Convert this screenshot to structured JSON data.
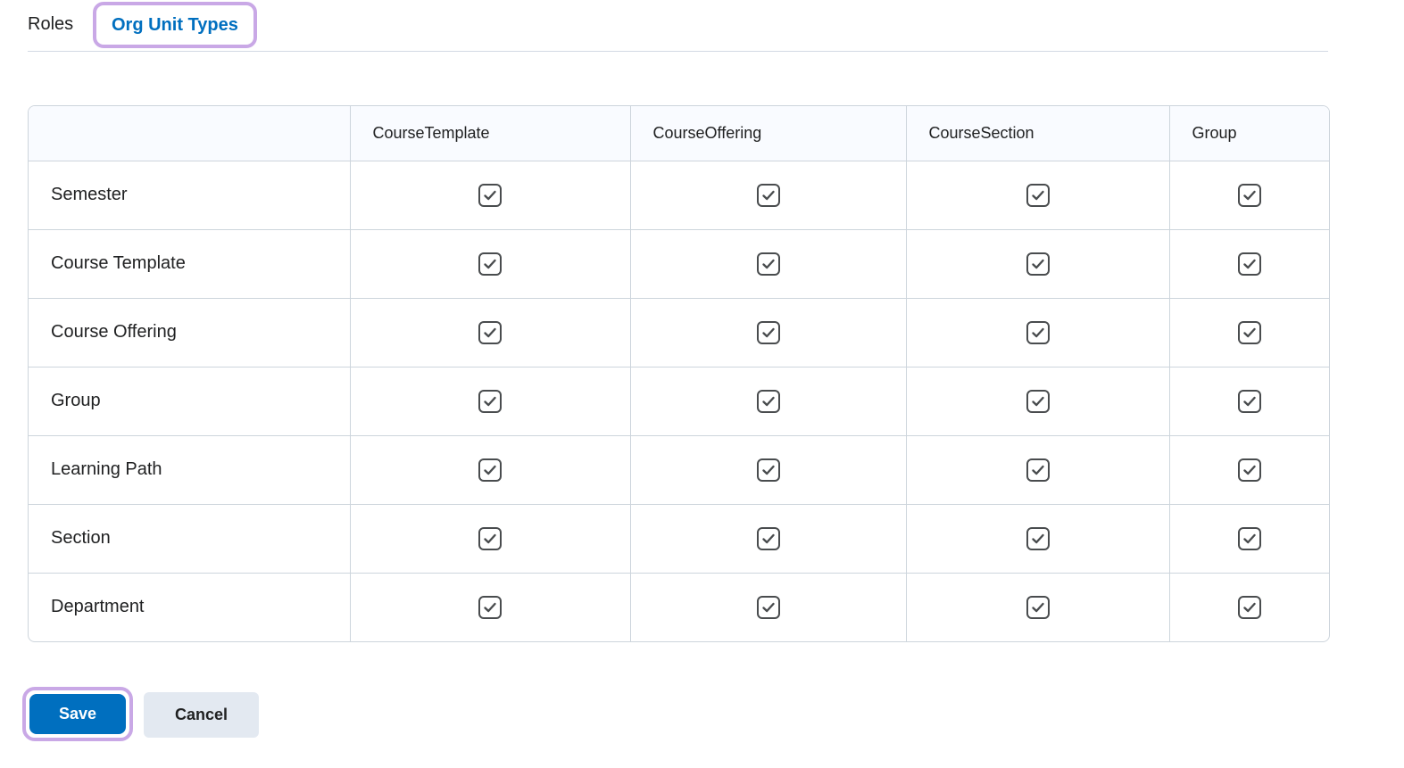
{
  "tabs": {
    "roles": "Roles",
    "org_unit_types": "Org Unit Types"
  },
  "table": {
    "columns": [
      "CourseTemplate",
      "CourseOffering",
      "CourseSection",
      "Group"
    ],
    "rows": [
      {
        "label": "Semester",
        "checked": [
          true,
          true,
          true,
          true
        ]
      },
      {
        "label": "Course Template",
        "checked": [
          true,
          true,
          true,
          true
        ]
      },
      {
        "label": "Course Offering",
        "checked": [
          true,
          true,
          true,
          true
        ]
      },
      {
        "label": "Group",
        "checked": [
          true,
          true,
          true,
          true
        ]
      },
      {
        "label": "Learning Path",
        "checked": [
          true,
          true,
          true,
          true
        ]
      },
      {
        "label": "Section",
        "checked": [
          true,
          true,
          true,
          true
        ]
      },
      {
        "label": "Department",
        "checked": [
          true,
          true,
          true,
          true
        ]
      }
    ]
  },
  "actions": {
    "save_label": "Save",
    "cancel_label": "Cancel"
  },
  "colors": {
    "accent": "#006fbf",
    "focus_ring": "#c9a8e6",
    "cancel_bg": "#e3e9f1",
    "border": "#cdd5dc"
  }
}
